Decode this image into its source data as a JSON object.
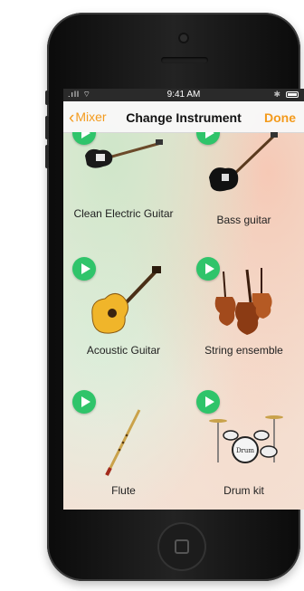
{
  "statusbar": {
    "time": "9:41 AM"
  },
  "navbar": {
    "back_label": "Mixer",
    "title": "Change Instrument",
    "done_label": "Done"
  },
  "instruments": [
    {
      "name": "Clean Electric Guitar"
    },
    {
      "name": "Bass guitar"
    },
    {
      "name": "Acoustic Guitar"
    },
    {
      "name": "String ensemble"
    },
    {
      "name": "Flute"
    },
    {
      "name": "Drum kit"
    }
  ],
  "colors": {
    "accent": "#f39a1c",
    "play": "#2fc46a"
  },
  "icons": [
    "chevron-left-icon",
    "play-icon",
    "signal-icon",
    "wifi-icon",
    "bluetooth-icon",
    "battery-icon"
  ]
}
